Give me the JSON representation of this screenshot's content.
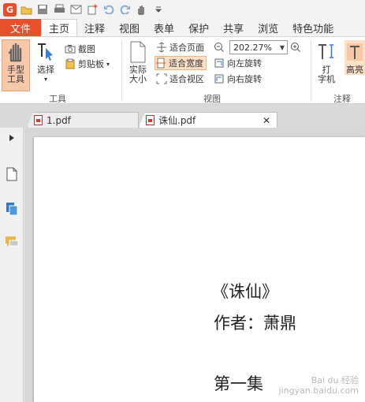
{
  "quick_access": {
    "logo": "G",
    "buttons": [
      "open-icon",
      "save-icon",
      "print-icon",
      "email-icon",
      "new-icon",
      "undo-icon",
      "redo-icon",
      "hand-menu-icon",
      "customize-icon"
    ]
  },
  "tabs": [
    {
      "label": "文件"
    },
    {
      "label": "主页"
    },
    {
      "label": "注释"
    },
    {
      "label": "视图"
    },
    {
      "label": "表单"
    },
    {
      "label": "保护"
    },
    {
      "label": "共享"
    },
    {
      "label": "浏览"
    },
    {
      "label": "特色功能"
    }
  ],
  "ribbon": {
    "tools": {
      "hand_tool": "手型\n工具",
      "select": "选择",
      "screenshot": "截图",
      "clipboard": "剪贴板",
      "group_label": "工具"
    },
    "view": {
      "actual_size": "实际\n大小",
      "fit_page": "适合页面",
      "fit_width": "适合宽度",
      "fit_visible": "适合视区",
      "zoom_value": "202.27%",
      "rotate_left": "向左旋转",
      "rotate_right": "向右旋转",
      "group_label": "视图"
    },
    "annotate": {
      "typewriter": "打\n字机",
      "highlight": "高亮",
      "group_label": "注释"
    }
  },
  "documents": [
    {
      "name": "1.pdf"
    },
    {
      "name": "诛仙.pdf"
    }
  ],
  "page": {
    "title": "《诛仙》",
    "author": "作者：萧鼎",
    "chapter": "第一集"
  },
  "watermark": {
    "line1": "Bai du 经验",
    "line2": "jingyan.baidu.com"
  },
  "colors": {
    "accent": "#e8502c",
    "selected": "#fde0c5"
  }
}
